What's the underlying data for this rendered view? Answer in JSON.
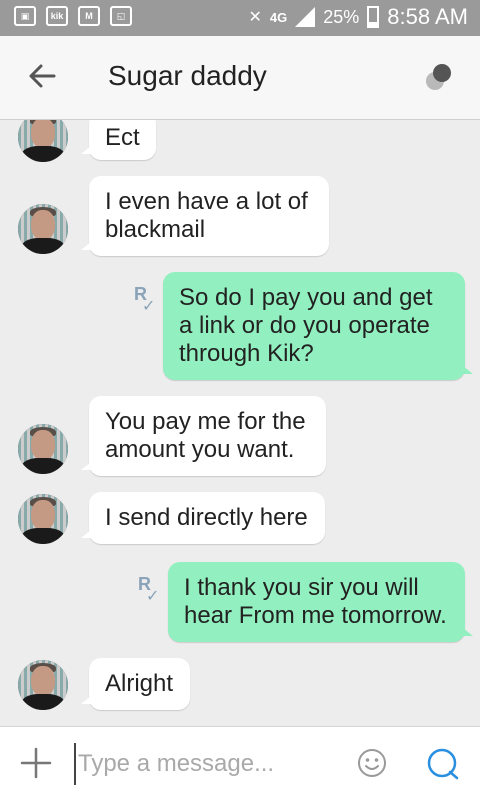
{
  "status_bar": {
    "left_icons": [
      "gallery-icon",
      "kik-notification-icon",
      "gmail-icon",
      "screenshot-icon"
    ],
    "kik_badge": "kik",
    "network": "4G",
    "battery": "25%",
    "time": "8:58 AM"
  },
  "header": {
    "title": "Sugar daddy",
    "back_icon": "arrow-back-icon",
    "menu_icon": "options-icon"
  },
  "messages": [
    {
      "direction": "in",
      "text": "Ect"
    },
    {
      "direction": "in",
      "text": "I even have a lot of blackmail"
    },
    {
      "direction": "out",
      "text": "So do I pay you and get a link or do you operate through Kik?",
      "receipt": "R"
    },
    {
      "direction": "in",
      "text": "You pay me for the amount you want."
    },
    {
      "direction": "in",
      "text": "I send directly here"
    },
    {
      "direction": "out",
      "text": "I thank you sir you will hear From me tomorrow.",
      "receipt": "R"
    },
    {
      "direction": "in",
      "text": "Alright"
    }
  ],
  "composer": {
    "placeholder": "Type a message...",
    "value": ""
  },
  "colors": {
    "outgoing_bubble": "#92f0c0",
    "incoming_bubble": "#ffffff",
    "background": "#ededed",
    "accent": "#2b8fe0"
  }
}
